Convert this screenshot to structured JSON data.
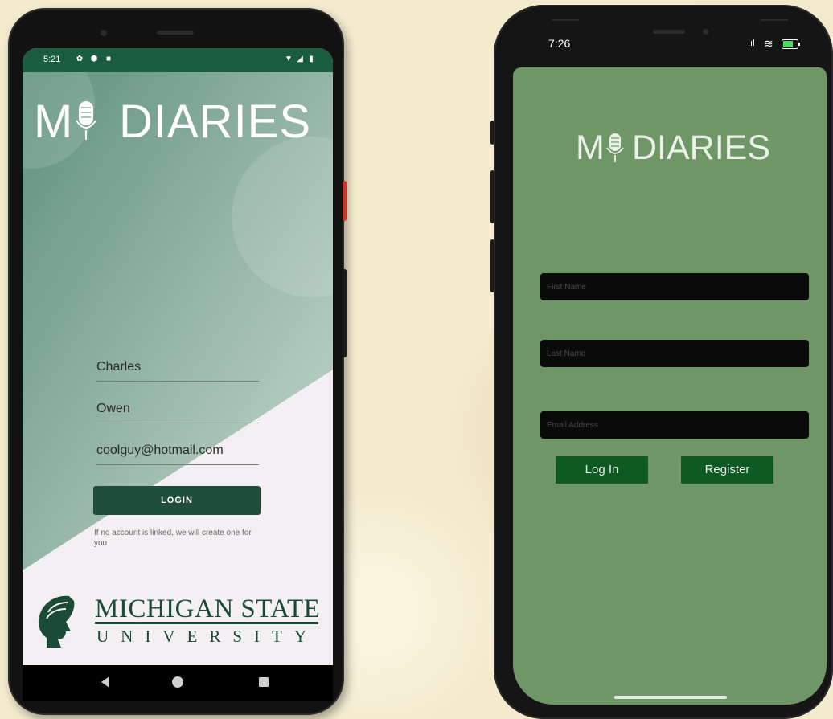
{
  "android": {
    "status": {
      "time": "5:21"
    },
    "title_letter": "M",
    "title_word": "DIARIES",
    "form": {
      "first_name_value": "Charles",
      "last_name_value": "Owen",
      "email_value": "coolguy@hotmail.com",
      "login_label": "LOGIN",
      "note": "If no account is linked, we will create one for you"
    },
    "logo": {
      "line1": "MICHIGAN STATE",
      "line2": "UNIVERSITY"
    },
    "nav": [
      "back-icon",
      "home-icon",
      "recents-icon"
    ],
    "colors": {
      "brand_green": "#1a5c40",
      "button": "#1f4f3b",
      "text_logo": "#1b4a36"
    }
  },
  "ios": {
    "status": {
      "time": "7:26"
    },
    "title_letter": "M",
    "title_word": "DIARIES",
    "form": {
      "first_name_placeholder": "First Name",
      "last_name_placeholder": "Last Name",
      "email_placeholder": "Email Address",
      "login_label": "Log In",
      "register_label": "Register"
    },
    "colors": {
      "screen_bg": "#6e9666",
      "button": "#0d5a23",
      "input_bg": "#0a0a0a"
    }
  }
}
